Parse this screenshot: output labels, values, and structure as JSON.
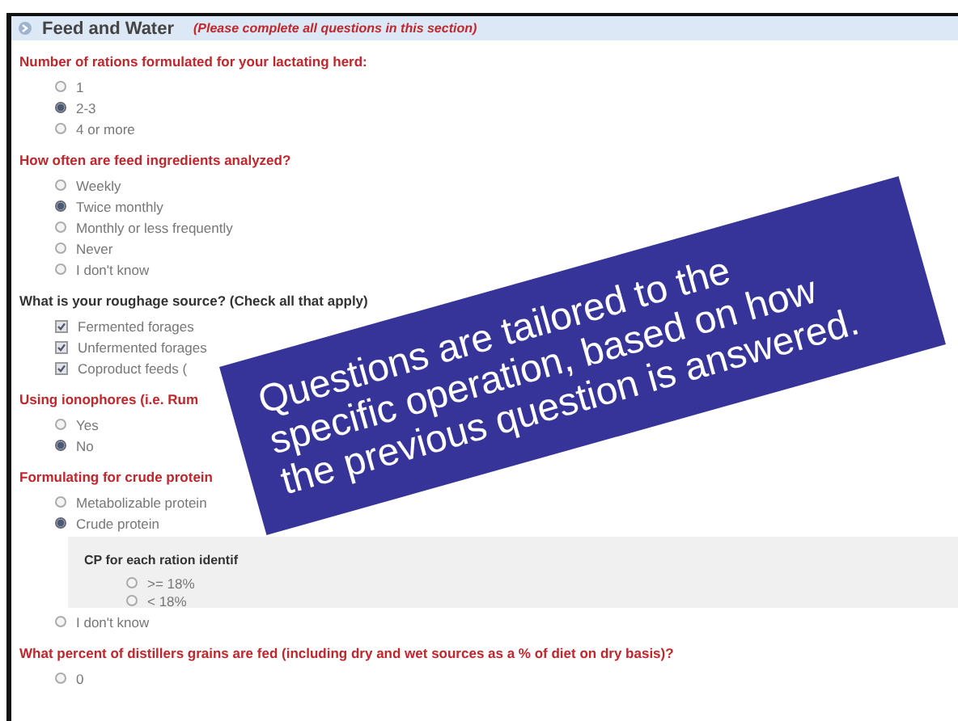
{
  "section": {
    "title": "Feed and Water",
    "note": "(Please complete all questions in this section)"
  },
  "questions": [
    {
      "kind": "radio",
      "label": "Number of rations formulated for your lactating herd:",
      "options": [
        {
          "label": "1",
          "selected": false
        },
        {
          "label": "2-3",
          "selected": true
        },
        {
          "label": "4 or more",
          "selected": false
        }
      ]
    },
    {
      "kind": "radio",
      "label": "How often are feed ingredients analyzed?",
      "options": [
        {
          "label": "Weekly",
          "selected": false
        },
        {
          "label": "Twice monthly",
          "selected": true
        },
        {
          "label": "Monthly or less frequently",
          "selected": false
        },
        {
          "label": "Never",
          "selected": false
        },
        {
          "label": "I don't know",
          "selected": false
        }
      ]
    },
    {
      "kind": "checkbox",
      "label": "What is your roughage source? (Check all that apply)",
      "options": [
        {
          "label": "Fermented forages",
          "checked": true
        },
        {
          "label": "Unfermented forages",
          "checked": true
        },
        {
          "label": "Coproduct feeds (",
          "checked": true
        }
      ]
    },
    {
      "kind": "radio",
      "label": "Using ionophores (i.e. Rum",
      "options": [
        {
          "label": "Yes",
          "selected": false
        },
        {
          "label": "No",
          "selected": true
        }
      ]
    },
    {
      "kind": "radio",
      "label": "Formulating for crude protein",
      "options": [
        {
          "label": "Metabolizable protein",
          "selected": false
        },
        {
          "label": "Crude protein",
          "selected": true,
          "followup": {
            "label": "CP for each ration identif",
            "options": [
              {
                "label": ">= 18%",
                "selected": false
              },
              {
                "label": "< 18%",
                "selected": false
              }
            ]
          }
        },
        {
          "label": "I don't know",
          "selected": false
        }
      ]
    },
    {
      "kind": "radio",
      "label": "What percent of distillers grains are fed (including dry and wet sources as a % of diet on dry basis)?",
      "options": [
        {
          "label": "0",
          "selected": false
        }
      ]
    }
  ],
  "callout": {
    "lines": [
      "Questions are tailored to the",
      "specific operation, based on how",
      "the previous question is answered."
    ]
  }
}
